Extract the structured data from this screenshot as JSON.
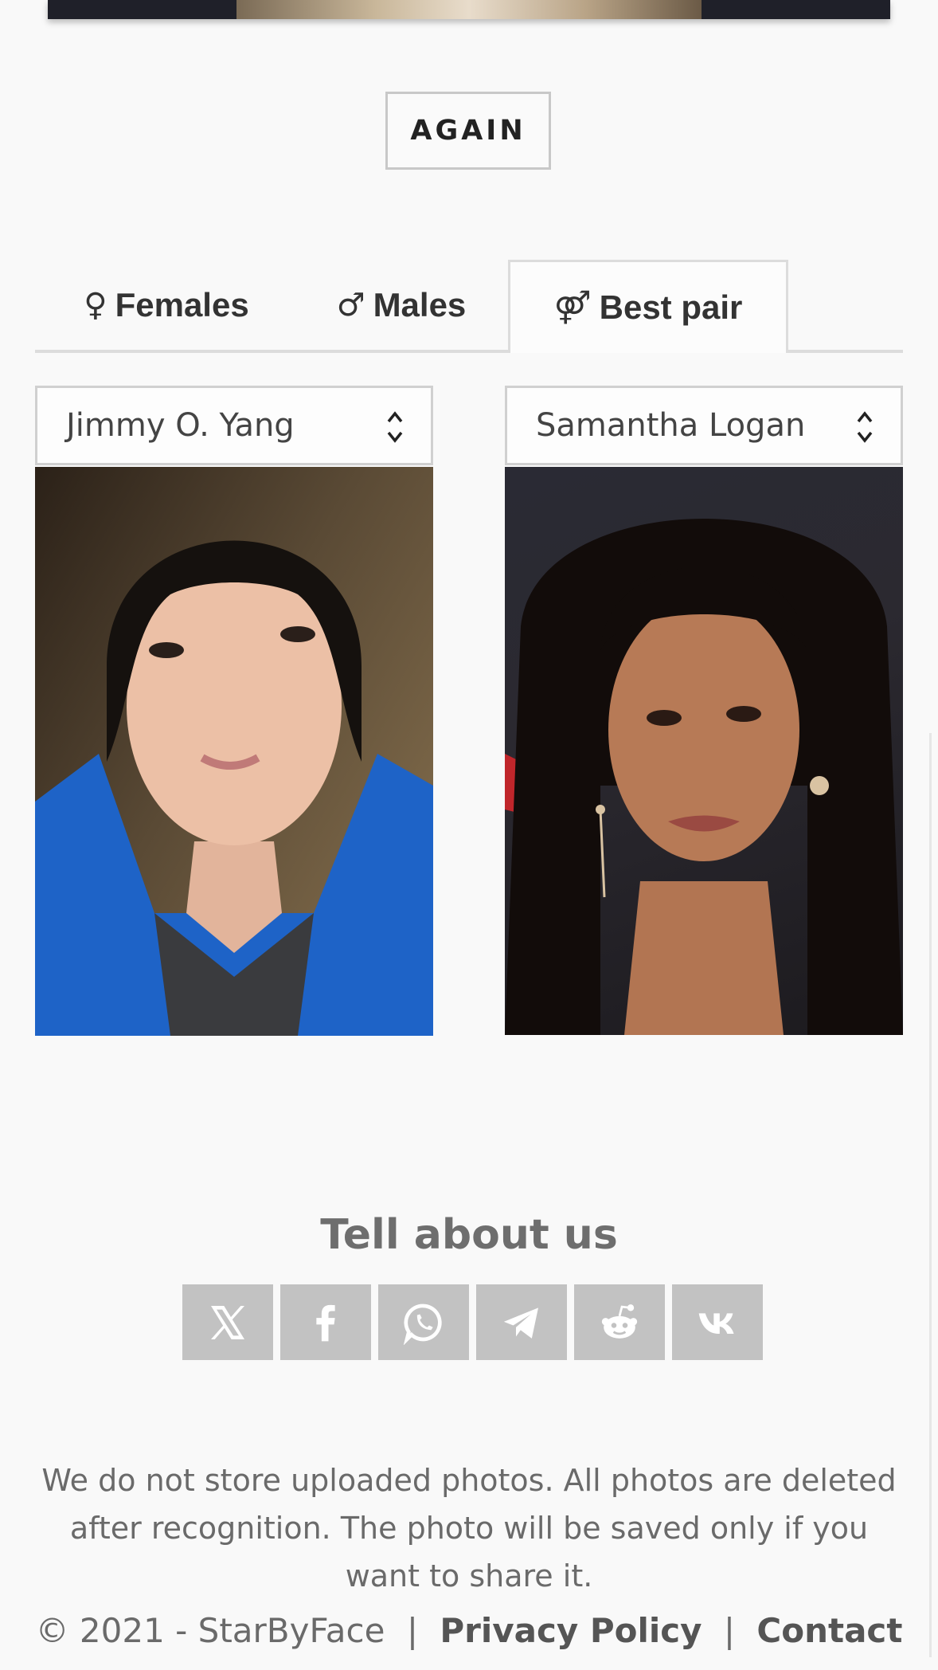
{
  "again_label": "AGAIN",
  "tabs": [
    {
      "symbol": "♀",
      "label": "Females",
      "active": false
    },
    {
      "symbol": "♂",
      "label": "Males",
      "active": false
    },
    {
      "symbol": "⚤",
      "label": "Best pair",
      "active": true
    }
  ],
  "selects": {
    "left_value": "Jimmy O. Yang",
    "right_value": "Samantha Logan"
  },
  "share": {
    "title": "Tell about us",
    "icons": [
      "x-icon",
      "facebook-icon",
      "whatsapp-icon",
      "telegram-icon",
      "reddit-icon",
      "vk-icon"
    ]
  },
  "footer": {
    "note": "We do not store uploaded photos. All photos are deleted after recognition. The photo will be saved only if you want to share it.",
    "copyright": "© 2021 - StarByFace",
    "separator": "|",
    "privacy_label": "Privacy Policy",
    "contact_label": "Contact"
  },
  "colors": {
    "background": "#f9f9f9",
    "share_button": "#c2c2c2",
    "tab_border": "#dcdcdc"
  }
}
